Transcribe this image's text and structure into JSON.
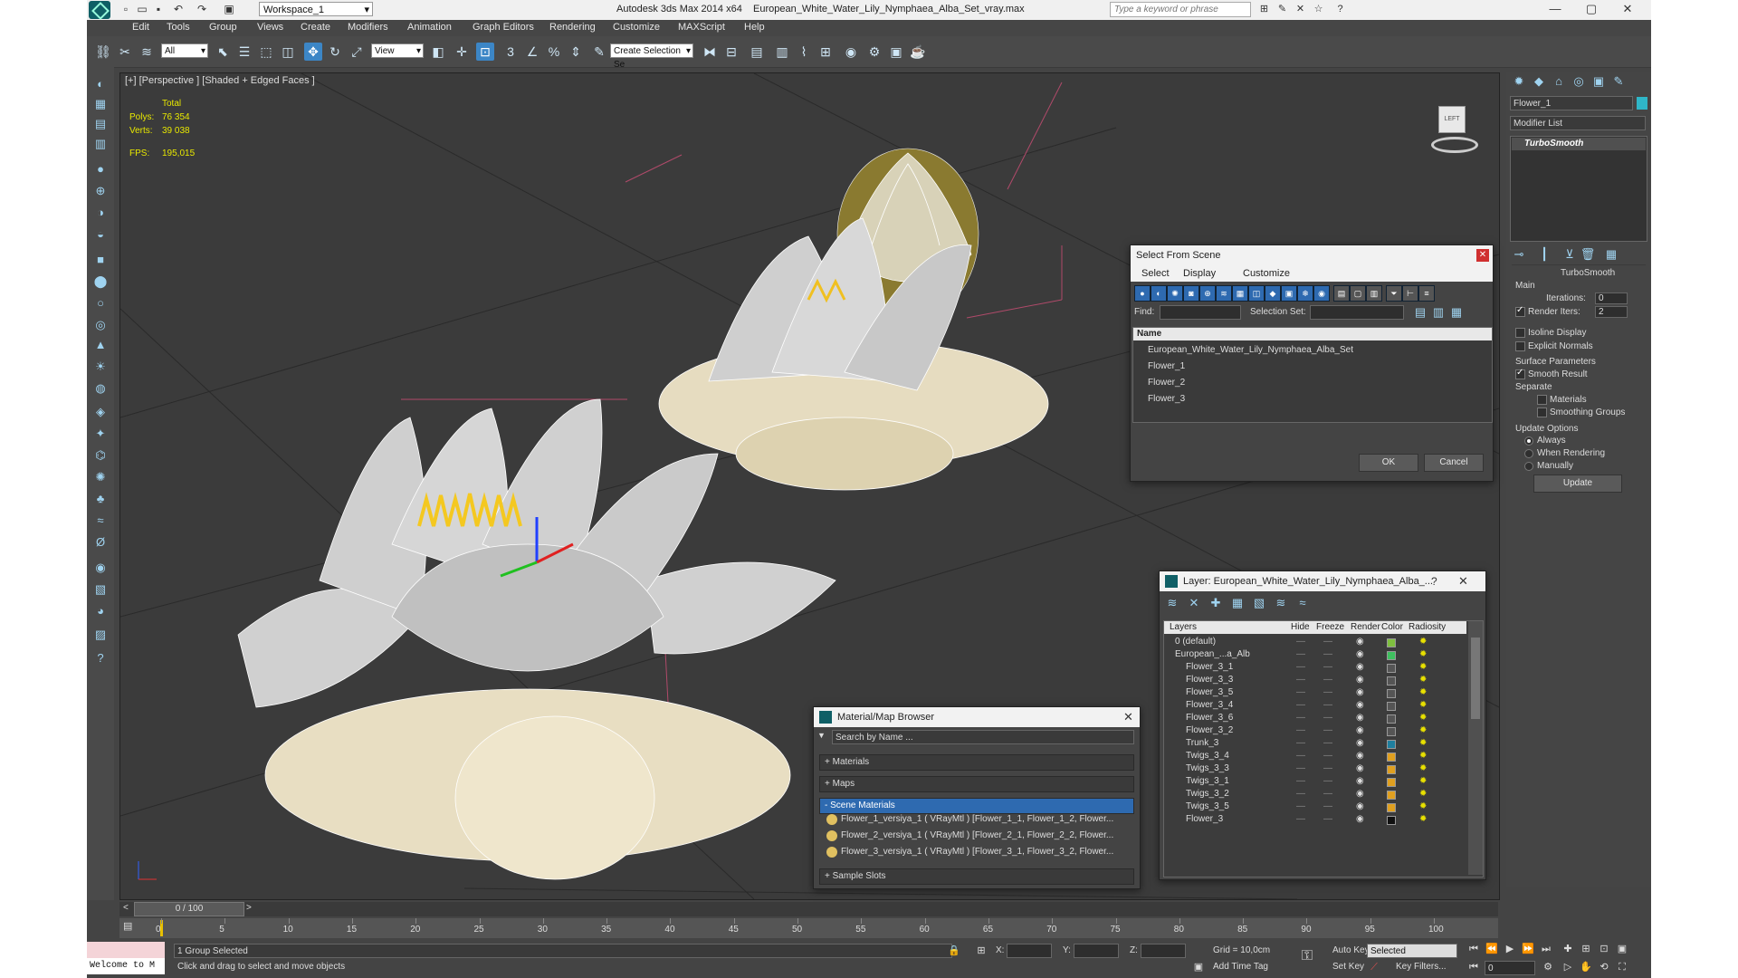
{
  "title": {
    "app": "Autodesk 3ds Max  2014 x64",
    "file": "European_White_Water_Lily_Nymphaea_Alba_Set_vray.max"
  },
  "workspace": "Workspace_1",
  "search_placeholder": "Type a keyword or phrase",
  "menu": [
    "Edit",
    "Tools",
    "Group",
    "Views",
    "Create",
    "Modifiers",
    "Animation",
    "Graph Editors",
    "Rendering",
    "Customize",
    "MAXScript",
    "Help"
  ],
  "toolbar": {
    "filter": "All",
    "refcoord": "View",
    "selection_set": "Create Selection Se"
  },
  "viewport": {
    "label": "[+] [Perspective ] [Shaded + Edged Faces ]",
    "stats": {
      "header": "Total",
      "polys_label": "Polys:",
      "polys": "76 354",
      "verts_label": "Verts:",
      "verts": "39 038",
      "fps_label": "FPS:",
      "fps": "195,015"
    },
    "viewcube_label": "LEFT"
  },
  "modify": {
    "object_name": "Flower_1",
    "modifier_list": "Modifier List",
    "stack_item": "TurboSmooth",
    "rollout": "TurboSmooth",
    "main": "Main",
    "iterations_label": "Iterations:",
    "iterations": "0",
    "render_iters_label": "Render Iters:",
    "render_iters": "2",
    "isoline": "Isoline Display",
    "explicit": "Explicit Normals",
    "surface": "Surface Parameters",
    "smooth_result": "Smooth Result",
    "separate": "Separate",
    "materials": "Materials",
    "smoothing": "Smoothing Groups",
    "update_options": "Update Options",
    "always": "Always",
    "when_rendering": "When Rendering",
    "manually": "Manually",
    "update_button": "Update"
  },
  "select_dialog": {
    "title": "Select From Scene",
    "tabs": [
      "Select",
      "Display",
      "Customize"
    ],
    "find_label": "Find:",
    "selset_label": "Selection Set:",
    "column": "Name",
    "items": [
      "European_White_Water_Lily_Nymphaea_Alba_Set",
      "Flower_1",
      "Flower_2",
      "Flower_3"
    ],
    "ok": "OK",
    "cancel": "Cancel"
  },
  "layer_dialog": {
    "title": "Layer: European_White_Water_Lily_Nymphaea_Alba_...",
    "help": "?",
    "columns": {
      "layers": "Layers",
      "hide": "Hide",
      "freeze": "Freeze",
      "render": "Render",
      "color": "Color",
      "radiosity": "Radiosity"
    },
    "rows": [
      {
        "name": "0 (default)",
        "color": "#7fbf3f",
        "indent": 1
      },
      {
        "name": "European_...a_Alb",
        "color": "#3fbf5f",
        "indent": 1
      },
      {
        "name": "Flower_3_1",
        "color": "#555555",
        "indent": 2
      },
      {
        "name": "Flower_3_3",
        "color": "#555555",
        "indent": 2
      },
      {
        "name": "Flower_3_5",
        "color": "#555555",
        "indent": 2
      },
      {
        "name": "Flower_3_4",
        "color": "#555555",
        "indent": 2
      },
      {
        "name": "Flower_3_6",
        "color": "#555555",
        "indent": 2
      },
      {
        "name": "Flower_3_2",
        "color": "#555555",
        "indent": 2
      },
      {
        "name": "Trunk_3",
        "color": "#1f7f9f",
        "indent": 2
      },
      {
        "name": "Twigs_3_4",
        "color": "#e0a020",
        "indent": 2
      },
      {
        "name": "Twigs_3_3",
        "color": "#e0a020",
        "indent": 2
      },
      {
        "name": "Twigs_3_1",
        "color": "#e0a020",
        "indent": 2
      },
      {
        "name": "Twigs_3_2",
        "color": "#e0a020",
        "indent": 2
      },
      {
        "name": "Twigs_3_5",
        "color": "#e0a020",
        "indent": 2
      },
      {
        "name": "Flower_3",
        "color": "#111111",
        "indent": 2
      }
    ]
  },
  "material_browser": {
    "title": "Material/Map Browser",
    "search": "Search by Name ...",
    "sections": [
      "+ Materials",
      "+ Maps"
    ],
    "scene_header": "- Scene Materials",
    "materials": [
      "Flower_1_versiya_1  ( VRayMtl ) [Flower_1_1, Flower_1_2, Flower...",
      "Flower_2_versiya_1  ( VRayMtl ) [Flower_2_1, Flower_2_2, Flower...",
      "Flower_3_versiya_1  ( VRayMtl ) [Flower_3_1, Flower_3_2, Flower..."
    ],
    "sample_slots": "+ Sample Slots"
  },
  "timeline": {
    "frame": "0 / 100",
    "ticks": [
      "0",
      "5",
      "10",
      "15",
      "20",
      "25",
      "30",
      "35",
      "40",
      "45",
      "50",
      "55",
      "60",
      "65",
      "70",
      "75",
      "80",
      "85",
      "90",
      "95",
      "100"
    ]
  },
  "status": {
    "maxscript": "Welcome to M",
    "selected": "1 Group Selected",
    "prompt": "Click and drag to select and move objects",
    "x_label": "X:",
    "y_label": "Y:",
    "z_label": "Z:",
    "grid": "Grid = 10,0cm",
    "add_time_tag": "Add Time Tag",
    "auto_key": "Auto Key",
    "set_key": "Set Key",
    "key_mode": "Selected",
    "key_filters": "Key Filters...",
    "frame_field": "0"
  },
  "colors": {
    "accent": "#3c86c6",
    "viewport": "#3b3b3b",
    "ui": "#444444",
    "stats_text": "#e8e800"
  }
}
